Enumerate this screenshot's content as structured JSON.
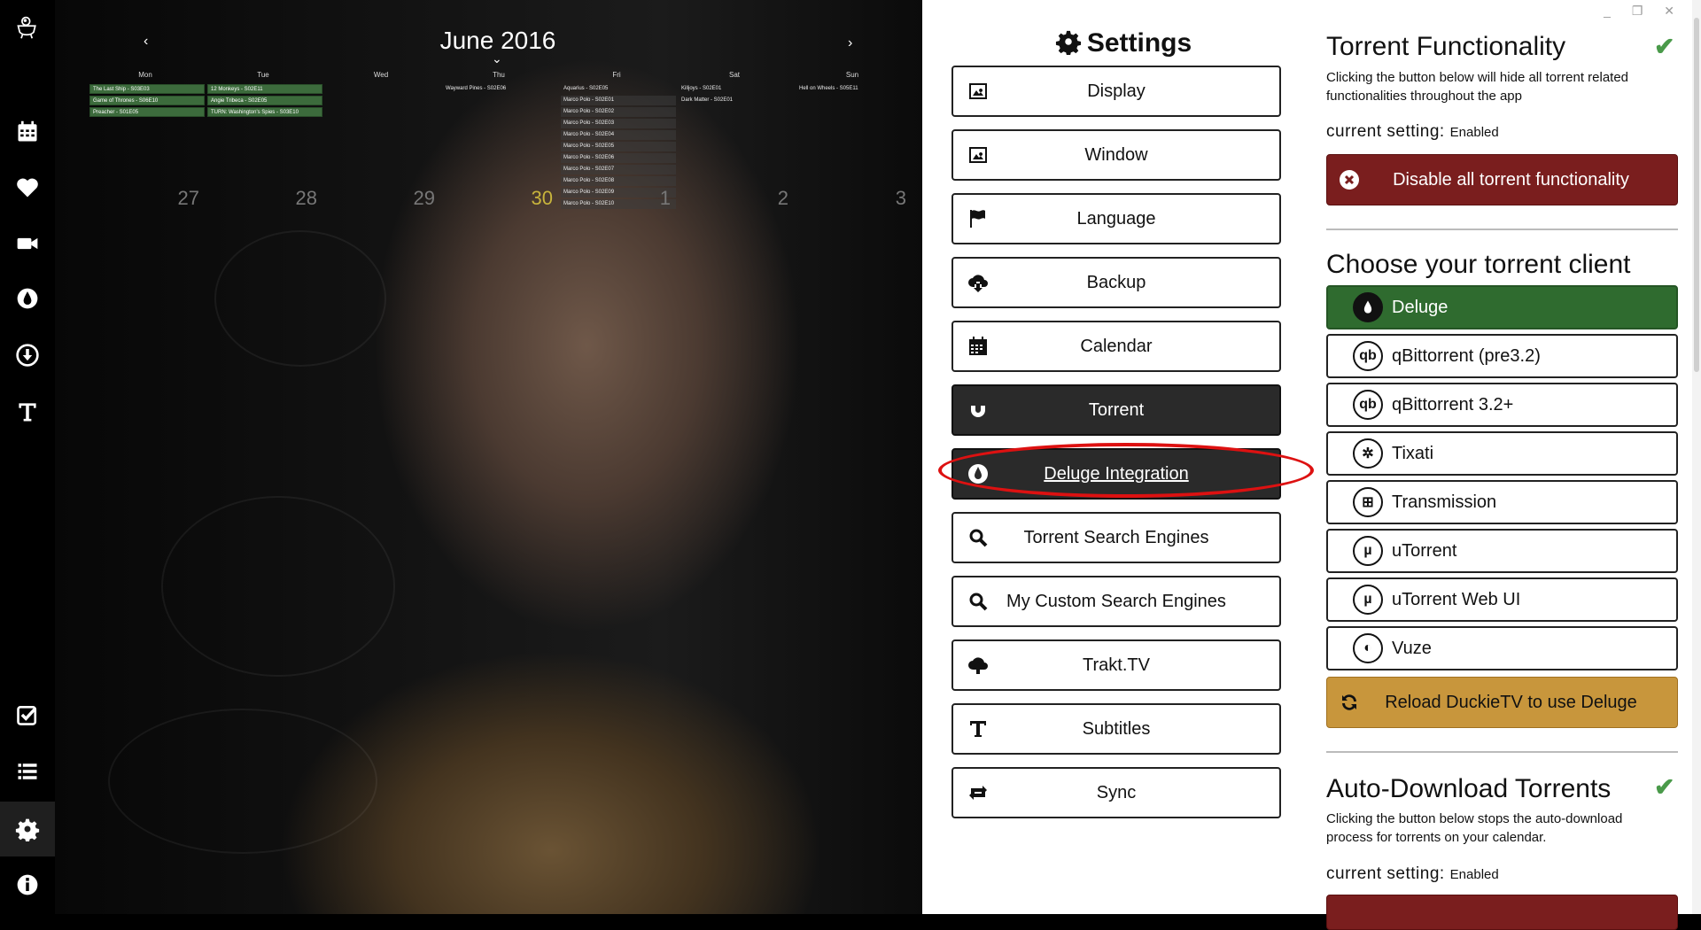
{
  "window_controls": "_ ❐ ✕",
  "sidebar": {
    "items": [
      {
        "name": "logo",
        "icon": "duck-icon"
      },
      {
        "name": "calendar",
        "icon": "calendar-icon"
      },
      {
        "name": "favorites",
        "icon": "heart-icon"
      },
      {
        "name": "series",
        "icon": "video-camera-icon"
      },
      {
        "name": "deluge",
        "icon": "deluge-drop-icon"
      },
      {
        "name": "downloads",
        "icon": "download-icon"
      },
      {
        "name": "subtitles",
        "icon": "text-icon"
      },
      {
        "name": "watched",
        "icon": "checkbox-icon"
      },
      {
        "name": "list",
        "icon": "list-icon"
      },
      {
        "name": "settings",
        "icon": "gear-icon",
        "active": true
      },
      {
        "name": "about",
        "icon": "info-icon"
      }
    ]
  },
  "calendar": {
    "title": "June 2016",
    "prev": "‹",
    "next": "›",
    "chevron": "⌄",
    "days": [
      "Mon",
      "Tue",
      "Wed",
      "Thu",
      "Fri",
      "Sat",
      "Sun"
    ],
    "mon_events": [
      "The Last Ship - S03E03",
      "Game of Thrones - S06E10",
      "Preacher - S01E05"
    ],
    "tue_events": [
      "12 Monkeys - S02E11",
      "Angie Tribeca - S02E05",
      "TURN: Washington's Spies - S03E10"
    ],
    "thu_events": [
      "Wayward Pines - S02E06"
    ],
    "fri_events": [
      "Aquarius - S02E05",
      "Marco Polo - S02E01",
      "Marco Polo - S02E02",
      "Marco Polo - S02E03",
      "Marco Polo - S02E04",
      "Marco Polo - S02E05",
      "Marco Polo - S02E06",
      "Marco Polo - S02E07",
      "Marco Polo - S02E08",
      "Marco Polo - S02E09",
      "Marco Polo - S02E10"
    ],
    "sat_events": [
      "Killjoys - S02E01",
      "Dark Matter - S02E01"
    ],
    "sun_events": [
      "Hell on Wheels - S05E11"
    ],
    "day_numbers": [
      "27",
      "28",
      "29",
      "30",
      "1",
      "2",
      "3"
    ]
  },
  "settings": {
    "title": "Settings",
    "buttons": [
      {
        "label": "Display",
        "icon": "image-icon"
      },
      {
        "label": "Window",
        "icon": "image-icon"
      },
      {
        "label": "Language",
        "icon": "flag-icon"
      },
      {
        "label": "Backup",
        "icon": "cloud-download-icon"
      },
      {
        "label": "Calendar",
        "icon": "calendar-icon"
      },
      {
        "label": "Torrent",
        "icon": "magnet-icon",
        "selected": true
      },
      {
        "label": "Deluge Integration",
        "icon": "deluge-drop-icon",
        "selected": true
      },
      {
        "label": "Torrent Search Engines",
        "icon": "search-icon"
      },
      {
        "label": "My Custom Search Engines",
        "icon": "search-icon"
      },
      {
        "label": "Trakt.TV",
        "icon": "cloud-upload-icon"
      },
      {
        "label": "Subtitles",
        "icon": "text-icon"
      },
      {
        "label": "Sync",
        "icon": "sync-icon"
      }
    ]
  },
  "panel": {
    "torrent_functionality": {
      "title": "Torrent Functionality",
      "description": "Clicking the button below will hide all torrent related functionalities throughout the app",
      "current_label": "current setting:",
      "current_value": "Enabled",
      "button": "Disable all torrent functionality"
    },
    "client_section": {
      "title": "Choose your torrent client",
      "clients": [
        {
          "label": "Deluge",
          "icon": "deluge-drop-icon",
          "selected": true
        },
        {
          "label": "qBittorrent (pre3.2)",
          "icon": "qbittorrent-icon",
          "glyph": "qb"
        },
        {
          "label": "qBittorrent 3.2+",
          "icon": "qbittorrent-icon",
          "glyph": "qb"
        },
        {
          "label": "Tixati",
          "icon": "tixati-icon",
          "glyph": "✲"
        },
        {
          "label": "Transmission",
          "icon": "transmission-icon",
          "glyph": "⊞"
        },
        {
          "label": "uTorrent",
          "icon": "utorrent-icon",
          "glyph": "µ"
        },
        {
          "label": "uTorrent Web UI",
          "icon": "utorrent-icon",
          "glyph": "µ"
        },
        {
          "label": "Vuze",
          "icon": "vuze-icon",
          "glyph": "◐"
        }
      ],
      "reload_button": "Reload DuckieTV to use Deluge"
    },
    "auto_download": {
      "title": "Auto-Download Torrents",
      "description": "Clicking the button below stops the auto-download process for torrents on your calendar.",
      "current_label": "current setting:",
      "current_value": "Enabled"
    },
    "check_mark": "✔"
  },
  "colors": {
    "selected_green": "#2f6b2f",
    "danger_red": "#7a1e1e",
    "warning_gold": "#c8963c",
    "highlight_oval": "#dd1111"
  }
}
